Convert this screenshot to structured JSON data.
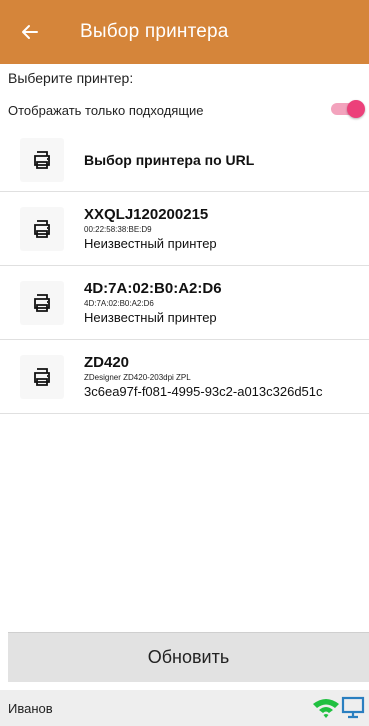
{
  "header": {
    "title": "Выбор принтера",
    "back_icon": "arrow-left-icon"
  },
  "select_label": "Выберите принтер:",
  "filter": {
    "label": "Отображать только подходящие",
    "enabled": true
  },
  "url_option": {
    "label": "Выбор принтера по URL"
  },
  "printers": [
    {
      "name": "XXQLJ120200215",
      "address": "00:22:58:38:BE:D9",
      "description": "Неизвестный принтер"
    },
    {
      "name": "4D:7A:02:B0:A2:D6",
      "address": "4D:7A:02:B0:A2:D6",
      "description": "Неизвестный принтер"
    },
    {
      "name": "ZD420",
      "address": "ZDesigner ZD420-203dpi ZPL",
      "description": "3c6ea97f-f081-4995-93c2-a013c326d51c"
    }
  ],
  "update_button": {
    "label": "Обновить"
  },
  "status": {
    "user": "Иванов",
    "wifi_icon": "wifi-icon",
    "device_icon": "monitor-icon"
  },
  "colors": {
    "header": "#d5853a",
    "toggle": "#ec407a",
    "wifi": "#20c040",
    "monitor": "#2a7fc0"
  }
}
